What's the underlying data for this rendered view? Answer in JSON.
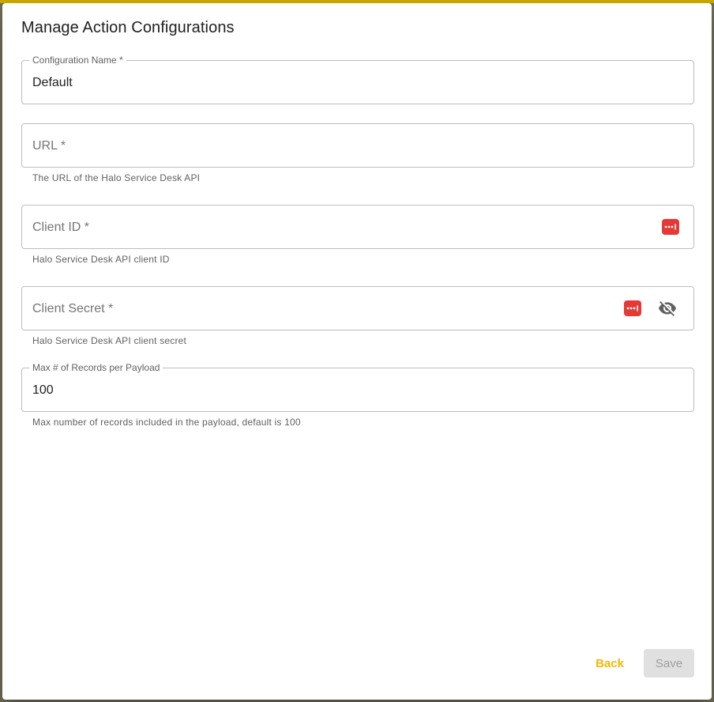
{
  "dialog": {
    "title": "Manage Action Configurations"
  },
  "fields": {
    "configuration_name": {
      "label": "Configuration Name *",
      "value": "Default"
    },
    "url": {
      "label": "URL *",
      "helper": "The URL of the Halo Service Desk API"
    },
    "client_id": {
      "label": "Client ID *",
      "helper": "Halo Service Desk API client ID"
    },
    "client_secret": {
      "label": "Client Secret *",
      "helper": "Halo Service Desk API client secret"
    },
    "max_records": {
      "label": "Max # of Records per Payload",
      "value": "100",
      "helper": "Max number of records included in the payload, default is 100"
    }
  },
  "actions": {
    "back_label": "Back",
    "save_label": "Save"
  },
  "icons": {
    "password_manager": "password-manager-icon",
    "visibility_off": "visibility-off-icon"
  },
  "colors": {
    "accent": "#f2b705",
    "password_manager_red": "#e53935"
  }
}
